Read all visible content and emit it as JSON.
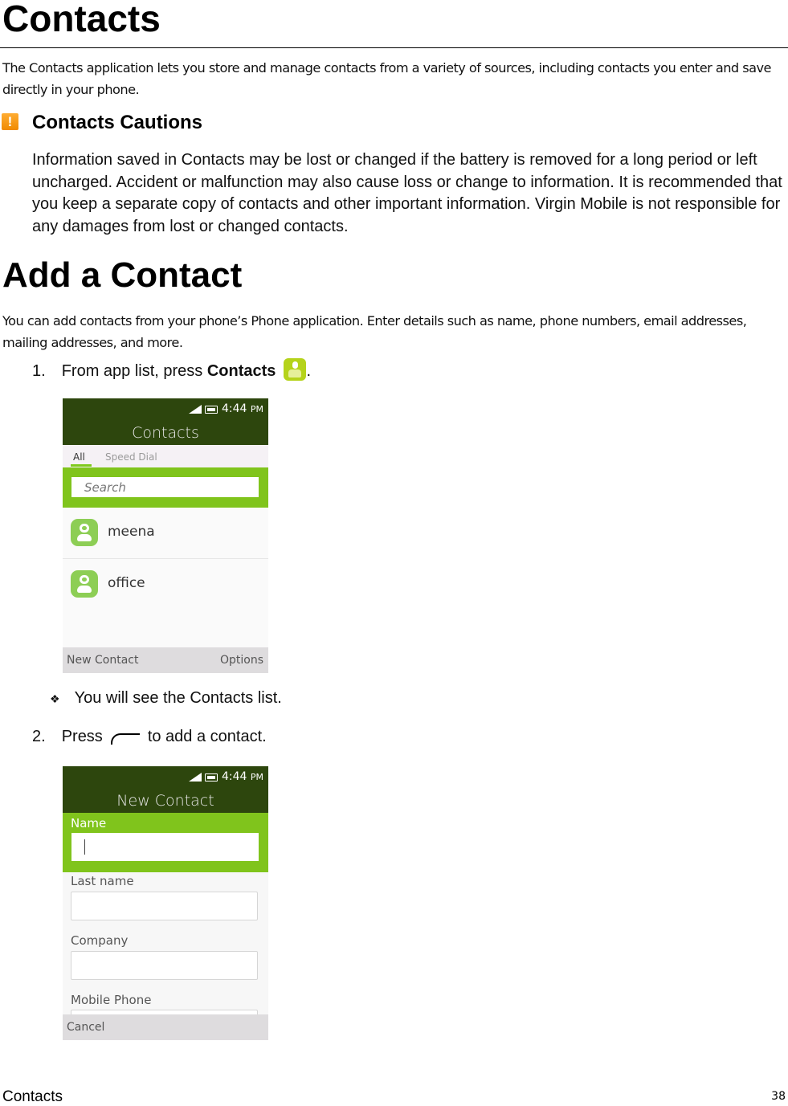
{
  "page": {
    "title": "Contacts",
    "intro": "The Contacts application lets you store and manage contacts from a variety of sources, including contacts you enter and save directly in your phone.",
    "caution": {
      "icon": "warning-icon",
      "heading": "Contacts Cautions",
      "text": "Information saved in Contacts may be lost or changed if the battery is removed for a long period or left uncharged. Accident or malfunction may also cause loss or change to information. It is recommended that you keep a separate copy of contacts and other important information. Virgin Mobile is not responsible for any damages from lost or changed contacts."
    },
    "section": {
      "heading": "Add a Contact",
      "intro": "You can add contacts from your phone’s Phone application. Enter details such as name, phone numbers, email addresses, mailing addresses, and more.",
      "step1": {
        "number": "1.",
        "prefix": "From app list, press ",
        "bold": "Contacts",
        "icon": "contacts-app-icon",
        "suffix": "."
      },
      "bullet": {
        "symbol": "❖",
        "text": "You will see the Contacts list."
      },
      "step2": {
        "number": "2.",
        "prefix": "Press",
        "icon": "left-soft-key-icon",
        "suffix": "to add a contact."
      }
    },
    "footer": {
      "left": "Contacts",
      "page_number": "38"
    }
  },
  "screen1": {
    "status_time": "4:44",
    "status_ampm": "PM",
    "title": "Contacts",
    "tabs": [
      {
        "label": "All",
        "active": true
      },
      {
        "label": "Speed Dial",
        "active": false
      }
    ],
    "search_placeholder": "Search",
    "contacts": [
      {
        "name": "meena"
      },
      {
        "name": "office"
      }
    ],
    "softkey_left": "New Contact",
    "softkey_right": "Options"
  },
  "screen2": {
    "status_time": "4:44",
    "status_ampm": "PM",
    "title": "New Contact",
    "fields": [
      {
        "label": "Name",
        "value": ""
      },
      {
        "label": "Last name",
        "value": ""
      },
      {
        "label": "Company",
        "value": ""
      },
      {
        "label": "Mobile  Phone",
        "value": ""
      }
    ],
    "softkey_left": "Cancel"
  },
  "colors": {
    "phone_header": "#2d460d",
    "phone_accent": "#80c41c",
    "warning": "#f59a0c"
  }
}
